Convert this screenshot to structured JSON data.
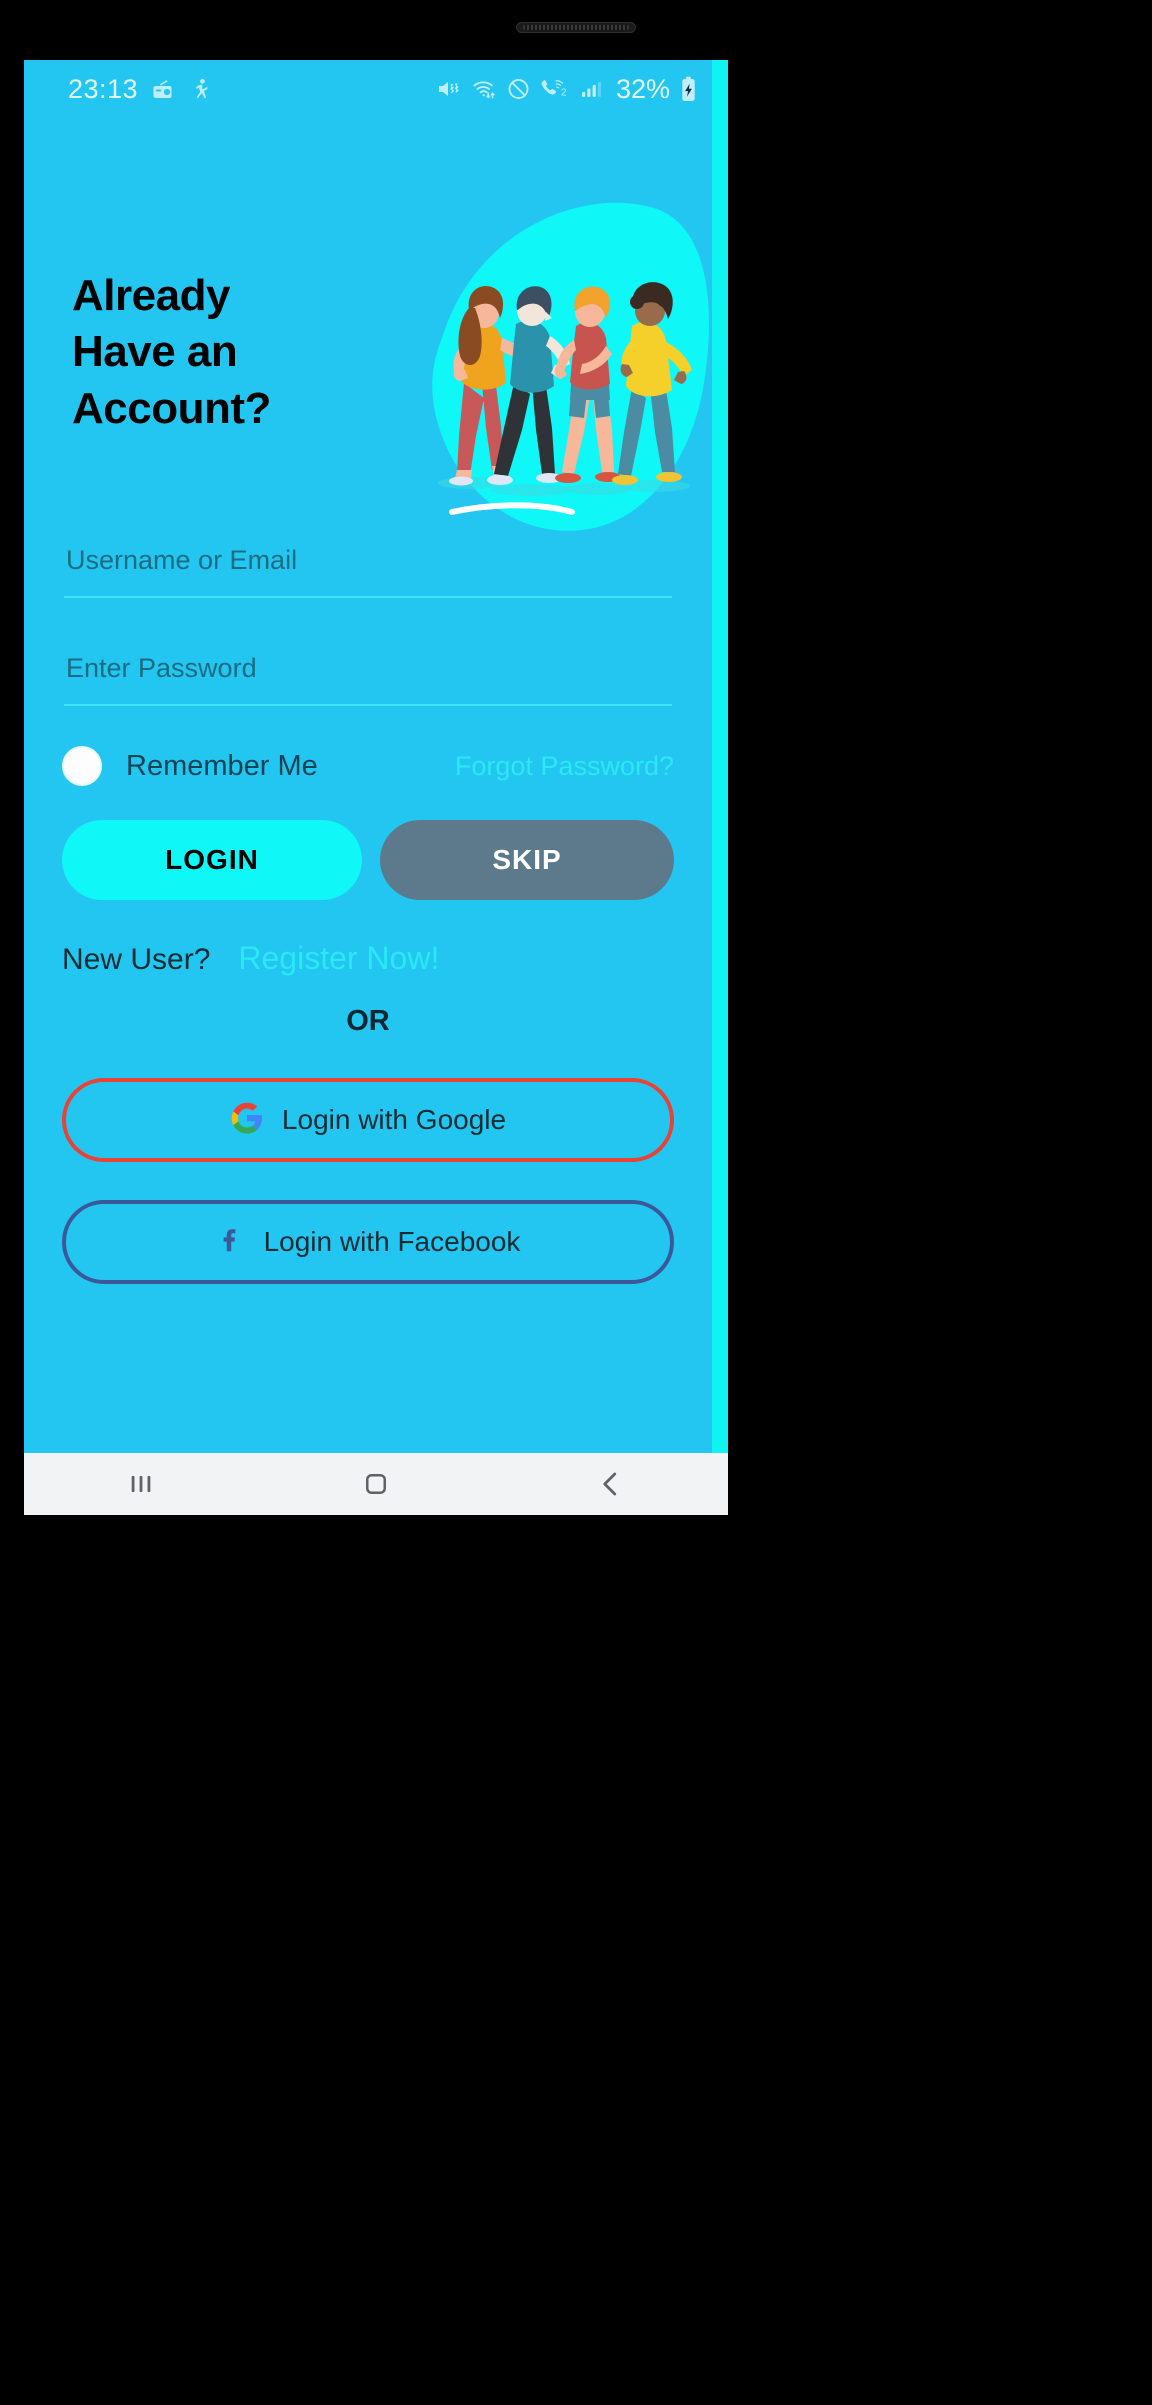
{
  "status_bar": {
    "clock": "23:13",
    "battery_percent": "32%",
    "left_icons": [
      "radio-icon",
      "accessibility-icon"
    ],
    "right_icons": [
      "volume-mute-vibrate-icon",
      "wifi-data-icon",
      "do-not-disturb-icon",
      "wifi-calling-2-icon",
      "cellular-signal-icon"
    ],
    "battery_icon": "battery-charging-icon"
  },
  "heading": {
    "line1": "Already",
    "line2": "Have an",
    "line3": "Account?"
  },
  "illustration": {
    "name": "four-people-walking-illustration",
    "blob_color": "#0ff7f7",
    "figures": [
      {
        "name": "woman-orange-top",
        "hair": "#8a4b22",
        "top": "#f0a41e",
        "legs": "#c8595b",
        "skin": "#f7b79a"
      },
      {
        "name": "person-teal-shirt",
        "hair": "#3d4f63",
        "top": "#2a93ab",
        "legs": "#2f3338",
        "skin": "#f2e6da"
      },
      {
        "name": "person-red-shirt",
        "hair": "#f3a22c",
        "top": "#c8544f",
        "legs": "#4b8ca3",
        "skin": "#f7b79a"
      },
      {
        "name": "person-yellow-jacket",
        "hair": "#3a2a22",
        "top": "#f5cf2a",
        "legs": "#4b8ca3",
        "skin": "#9a6b4a"
      }
    ]
  },
  "form": {
    "username": {
      "value": "",
      "placeholder": "Username or Email"
    },
    "password": {
      "value": "",
      "placeholder": "Enter Password"
    },
    "remember_label": "Remember Me",
    "remember_checked": false,
    "forgot_label": "Forgot Password?"
  },
  "actions": {
    "login_label": "LOGIN",
    "skip_label": "SKIP"
  },
  "signup": {
    "new_user_label": "New User?",
    "register_label": "Register Now!",
    "or_label": "OR"
  },
  "social": {
    "google_label": "Login with Google",
    "facebook_label": "Login with Facebook"
  },
  "nav_bar": {
    "recents": "recents-icon",
    "home": "home-icon",
    "back": "back-icon"
  },
  "colors": {
    "background": "#23c6f0",
    "accent_cyan": "#0ff7f7",
    "link_cyan": "#2ae8f5",
    "skip_grey": "#5c7a8c",
    "google_red": "#ea4335",
    "facebook_blue": "#3b5998",
    "dark_text": "#0d4354"
  }
}
